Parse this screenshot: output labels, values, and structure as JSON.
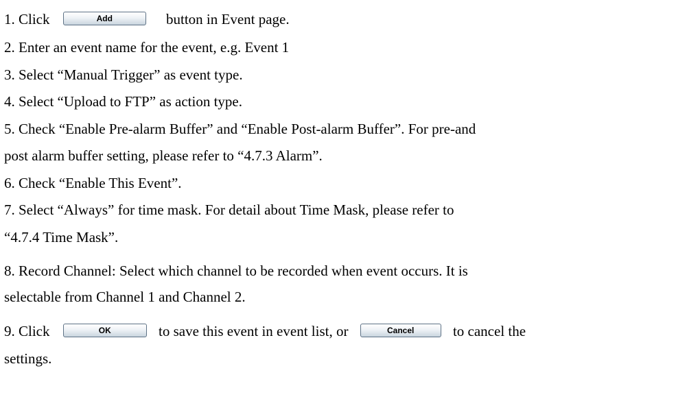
{
  "steps": {
    "s1": {
      "before": "1. Click",
      "button": "Add",
      "after": "button in Event page."
    },
    "s2": "2. Enter an event name for the event, e.g. Event 1",
    "s3": "3. Select “Manual Trigger” as event type.",
    "s4": "4. Select “Upload to FTP” as action type.",
    "s5a": "5. Check “Enable Pre-alarm Buffer” and “Enable Post-alarm Buffer”. For pre-and",
    "s5b": "post alarm buffer setting, please refer to “4.7.3 Alarm”.",
    "s6": "6. Check “Enable This Event”.",
    "s7a": "7. Select “Always” for time mask. For detail about Time Mask, please refer to",
    "s7b": "“4.7.4 Time Mask”.",
    "s8a": "8. Record Channel: Select which channel to be recorded when event occurs. It is",
    "s8b": "selectable from Channel 1 and Channel 2.",
    "s9": {
      "before": "9. Click",
      "ok_button": "OK",
      "middle": "to save this event in event list, or",
      "cancel_button": "Cancel",
      "after": "to cancel the"
    },
    "s9b": "settings."
  }
}
